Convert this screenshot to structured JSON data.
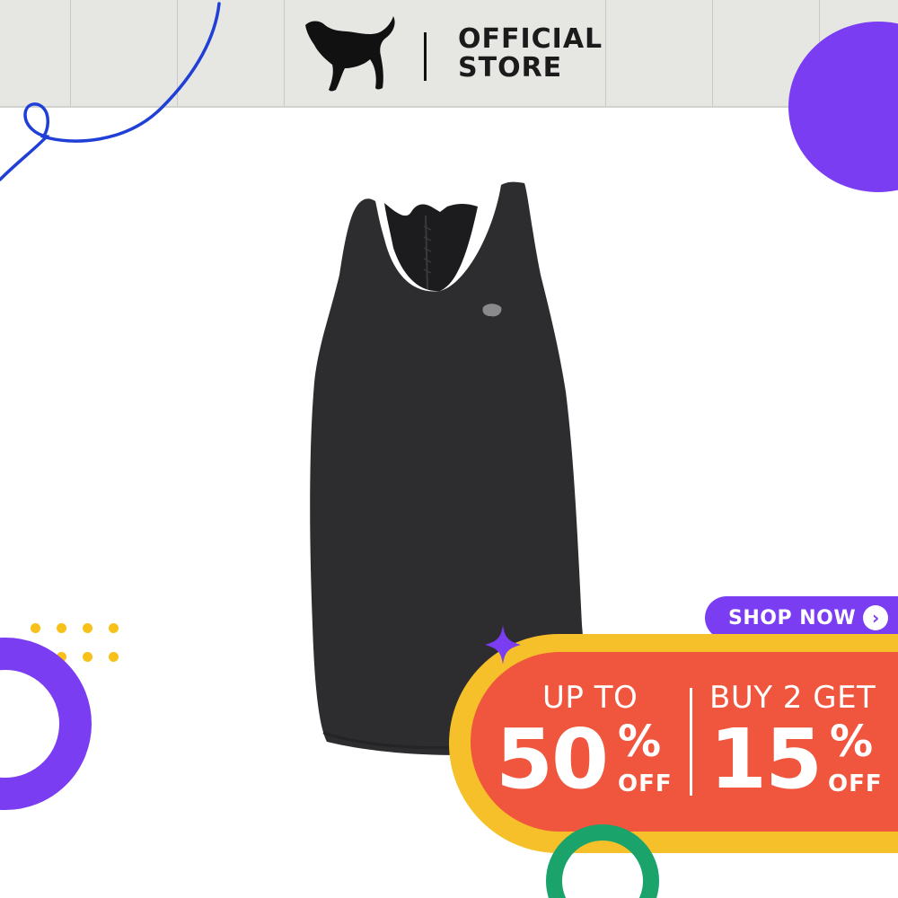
{
  "brand": {
    "name": "PUMA",
    "store_line1": "OFFICIAL",
    "store_line2": "STORE"
  },
  "product": {
    "item": "black racerback tank top"
  },
  "promo": {
    "cta_label": "SHOP NOW",
    "cta_icon": "chevron-right-icon",
    "deal1": {
      "prefix": "UP TO",
      "value": "50",
      "percent": "%",
      "suffix": "OFF"
    },
    "deal2": {
      "prefix": "BUY 2 GET",
      "value": "15",
      "percent": "%",
      "suffix": "OFF"
    }
  },
  "colors": {
    "purple": "#7a3df2",
    "red": "#f0553e",
    "yellow": "#f6c02a",
    "green": "#1aa36a",
    "blue": "#1f3fd6",
    "header_bg": "#e6e6e3"
  }
}
